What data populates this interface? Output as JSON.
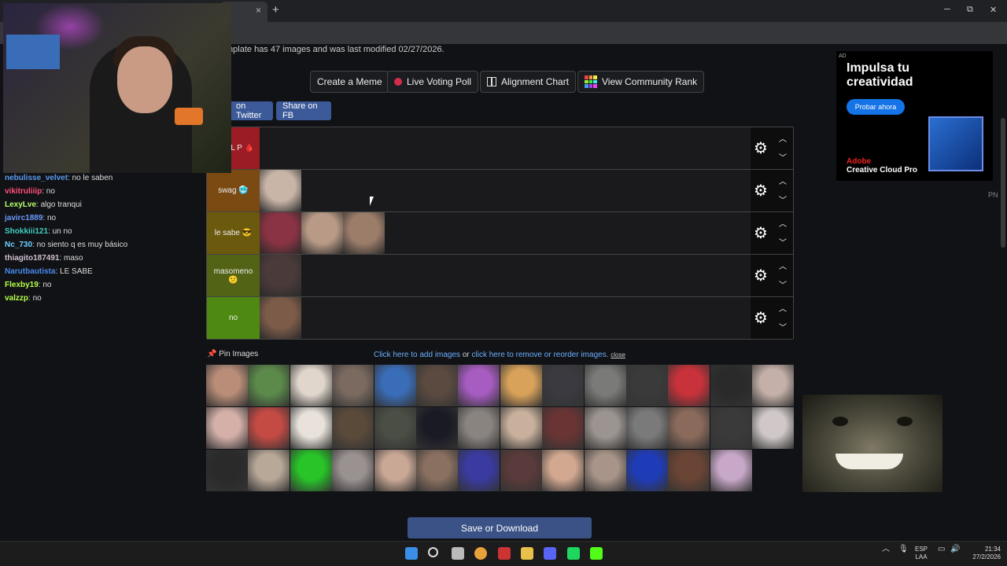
{
  "browser": {
    "url": "a-19188820",
    "tab_close": "×",
    "new_tab": "+",
    "window": {
      "minimize": "─",
      "restore": "⧉",
      "close": "✕"
    }
  },
  "page": {
    "subtitle": "mplate has 47 images and was last modified 02/27/2026.",
    "buttons": {
      "create_meme": "Create a Meme",
      "live_poll": "Live Voting Poll",
      "alignment_chart": "Alignment Chart",
      "community_rank": "View Community Rank"
    },
    "share": {
      "twitter": "on Twitter",
      "facebook": "Share on FB"
    },
    "tiers": [
      {
        "label": "S DEL P 🩸",
        "color": "#9b1c24",
        "images": []
      },
      {
        "label": "swag 🥶",
        "color": "#7a4a12",
        "images": [
          "#c9b5a8"
        ]
      },
      {
        "label": "le sabe 😎",
        "color": "#6b5a0e",
        "images": [
          "#8a3344",
          "#b89a86",
          "#9c7d6a"
        ]
      },
      {
        "label": "masomeno 😕",
        "color": "#536316",
        "images": [
          "#4a3a3a"
        ]
      },
      {
        "label": "no",
        "color": "#4e8a12",
        "images": [
          "#7c5b49"
        ]
      }
    ],
    "tier_controls": {
      "gear": "⚙",
      "up": "︿",
      "down": "﹀"
    },
    "pin": {
      "icon": "📌",
      "label": "Pin Images"
    },
    "add_images": {
      "add": "Click here to add images",
      "or": " or ",
      "remove": "click here to remove or reorder images.",
      "close": "close"
    },
    "gallery": [
      "#b98d78",
      "#5b8a4a",
      "#e0d6cc",
      "#7a6a60",
      "#3a6db8",
      "#5a4a40",
      "#a65cc0",
      "#d8a25a",
      "#3a3a40",
      "#7a7a78",
      "#3a3a3a",
      "#c8323a",
      "#2a2a2a",
      "#c4b0a8",
      "#d4b0a8",
      "#c44a44",
      "#e8e2da",
      "#5a4a3a",
      "#4a4e44",
      "#1a1a24",
      "#8a8480",
      "#c8b09c",
      "#6a3434",
      "#9c9490",
      "#7a7a7a",
      "#8a6a5a",
      "#3a3a3a",
      "#d0c8c8",
      "#2a2a2a",
      "#b8a898",
      "#28c428",
      "#9a9290",
      "#caa896",
      "#8a7060",
      "#3a3aa0",
      "#5a3a3a",
      "#d2a890",
      "#a89488",
      "#1f3cb8",
      "#6a4434",
      "#c8a8c8"
    ],
    "save_button": "Save or Download"
  },
  "ad": {
    "badge": "AD",
    "headline": "Impulsa tu creatividad",
    "cta": "Probar ahora",
    "brand_line1": "Adobe",
    "brand_line2": "Creative Cloud Pro",
    "corner": "PN"
  },
  "chat": [
    {
      "user": "nebulisse_velvet",
      "color": "#5a9af0",
      "text": ": no le saben"
    },
    {
      "user": "vikitruliiip",
      "color": "#ff4f7a",
      "text": ": no"
    },
    {
      "user": "LexyLve",
      "color": "#b4ff6a",
      "text": ": algo tranqui"
    },
    {
      "user": "javirc1889",
      "color": "#6a9aff",
      "text": ": no"
    },
    {
      "user": "Shokkiii121",
      "color": "#40d0c0",
      "text": ": un no"
    },
    {
      "user": "Nc_730",
      "color": "#6ad0ff",
      "text": ": no siento q es muy básico"
    },
    {
      "user": "thiagito187491",
      "color": "#d0c0d0",
      "text": ": maso"
    },
    {
      "user": "Narutbautista",
      "color": "#4a8af0",
      "text": ": LE SABE"
    },
    {
      "user": "Flexby19",
      "color": "#b4ff4a",
      "text": ": no"
    },
    {
      "user": "valzzp",
      "color": "#b4ff4a",
      "text": ": no"
    }
  ],
  "taskbar": {
    "lang": "ESP",
    "lang2": "LAA",
    "time": "21:34",
    "date": "27/2/2026",
    "icons": [
      "windows-icon",
      "search-icon",
      "chatgpt-icon",
      "chrome-icon",
      "news-icon",
      "files-icon",
      "discord-icon",
      "spotify-icon",
      "kick-icon"
    ]
  }
}
